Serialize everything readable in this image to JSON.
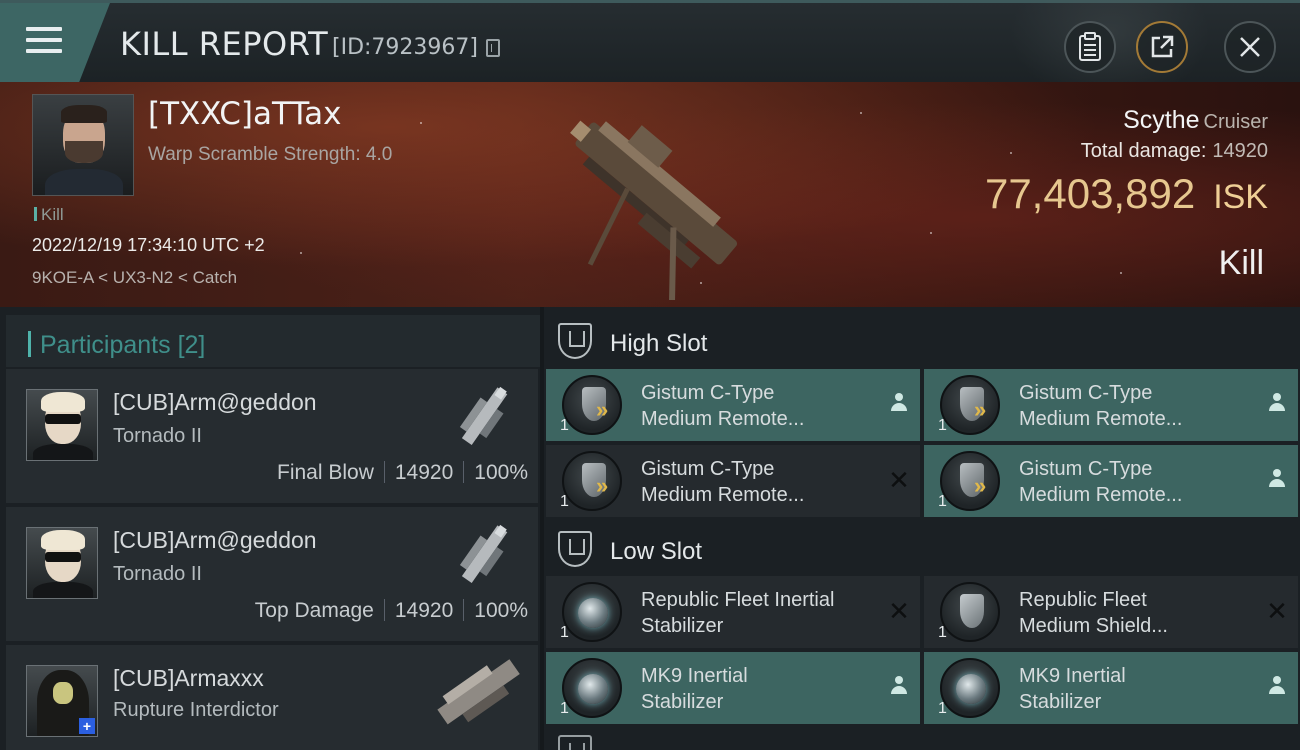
{
  "header": {
    "title": "KILL REPORT",
    "report_id": "[ID:7923967]",
    "icons": [
      "menu-icon",
      "copy-icon",
      "clipboard-icon",
      "share-icon",
      "close-icon"
    ]
  },
  "victim": {
    "name": "[TXXC]aTTax",
    "subtitle": "Warp Scramble Strength: 4.0",
    "tag": "Kill",
    "datetime": "2022/12/19 17:34:10 UTC +2",
    "location": "9KOE-A < UX3-N2 < Catch",
    "ship_name": "Scythe",
    "ship_class": "Cruiser",
    "total_damage_label": "Total damage:",
    "total_damage": "14920",
    "isk_value": "77,403,892",
    "isk_unit": "ISK",
    "result": "Kill"
  },
  "participants": {
    "title": "Participants",
    "count": "[2]",
    "items": [
      {
        "name": "[CUB]Arm@geddon",
        "ship": "Tornado II",
        "role": "Final Blow",
        "damage": "14920",
        "percent": "100%"
      },
      {
        "name": "[CUB]Arm@geddon",
        "ship": "Tornado II",
        "role": "Top Damage",
        "damage": "14920",
        "percent": "100%"
      },
      {
        "name": "[CUB]Armaxxx",
        "ship": "Rupture Interdictor"
      }
    ]
  },
  "fitting": {
    "high_slot": {
      "title": "High Slot",
      "modules": [
        {
          "line1": "Gistum C-Type",
          "line2": "Medium Remote...",
          "qty": "1",
          "status": "dropped"
        },
        {
          "line1": "Gistum C-Type",
          "line2": "Medium Remote...",
          "qty": "1",
          "status": "dropped"
        },
        {
          "line1": "Gistum C-Type",
          "line2": "Medium Remote...",
          "qty": "1",
          "status": "destroyed"
        },
        {
          "line1": "Gistum C-Type",
          "line2": "Medium Remote...",
          "qty": "1",
          "status": "dropped"
        }
      ]
    },
    "low_slot": {
      "title": "Low Slot",
      "modules": [
        {
          "line1": "Republic Fleet Inertial",
          "line2": "Stabilizer",
          "qty": "1",
          "status": "destroyed"
        },
        {
          "line1": "Republic Fleet",
          "line2": "Medium Shield...",
          "qty": "1",
          "status": "destroyed"
        },
        {
          "line1": "MK9 Inertial",
          "line2": "Stabilizer",
          "qty": "1",
          "status": "dropped"
        },
        {
          "line1": "MK9 Inertial",
          "line2": "Stabilizer",
          "qty": "1",
          "status": "dropped"
        }
      ]
    }
  },
  "colors": {
    "accent_teal": "#3d6664",
    "isk_gold": "#e6c78f",
    "banner_red": "#4b2118"
  }
}
